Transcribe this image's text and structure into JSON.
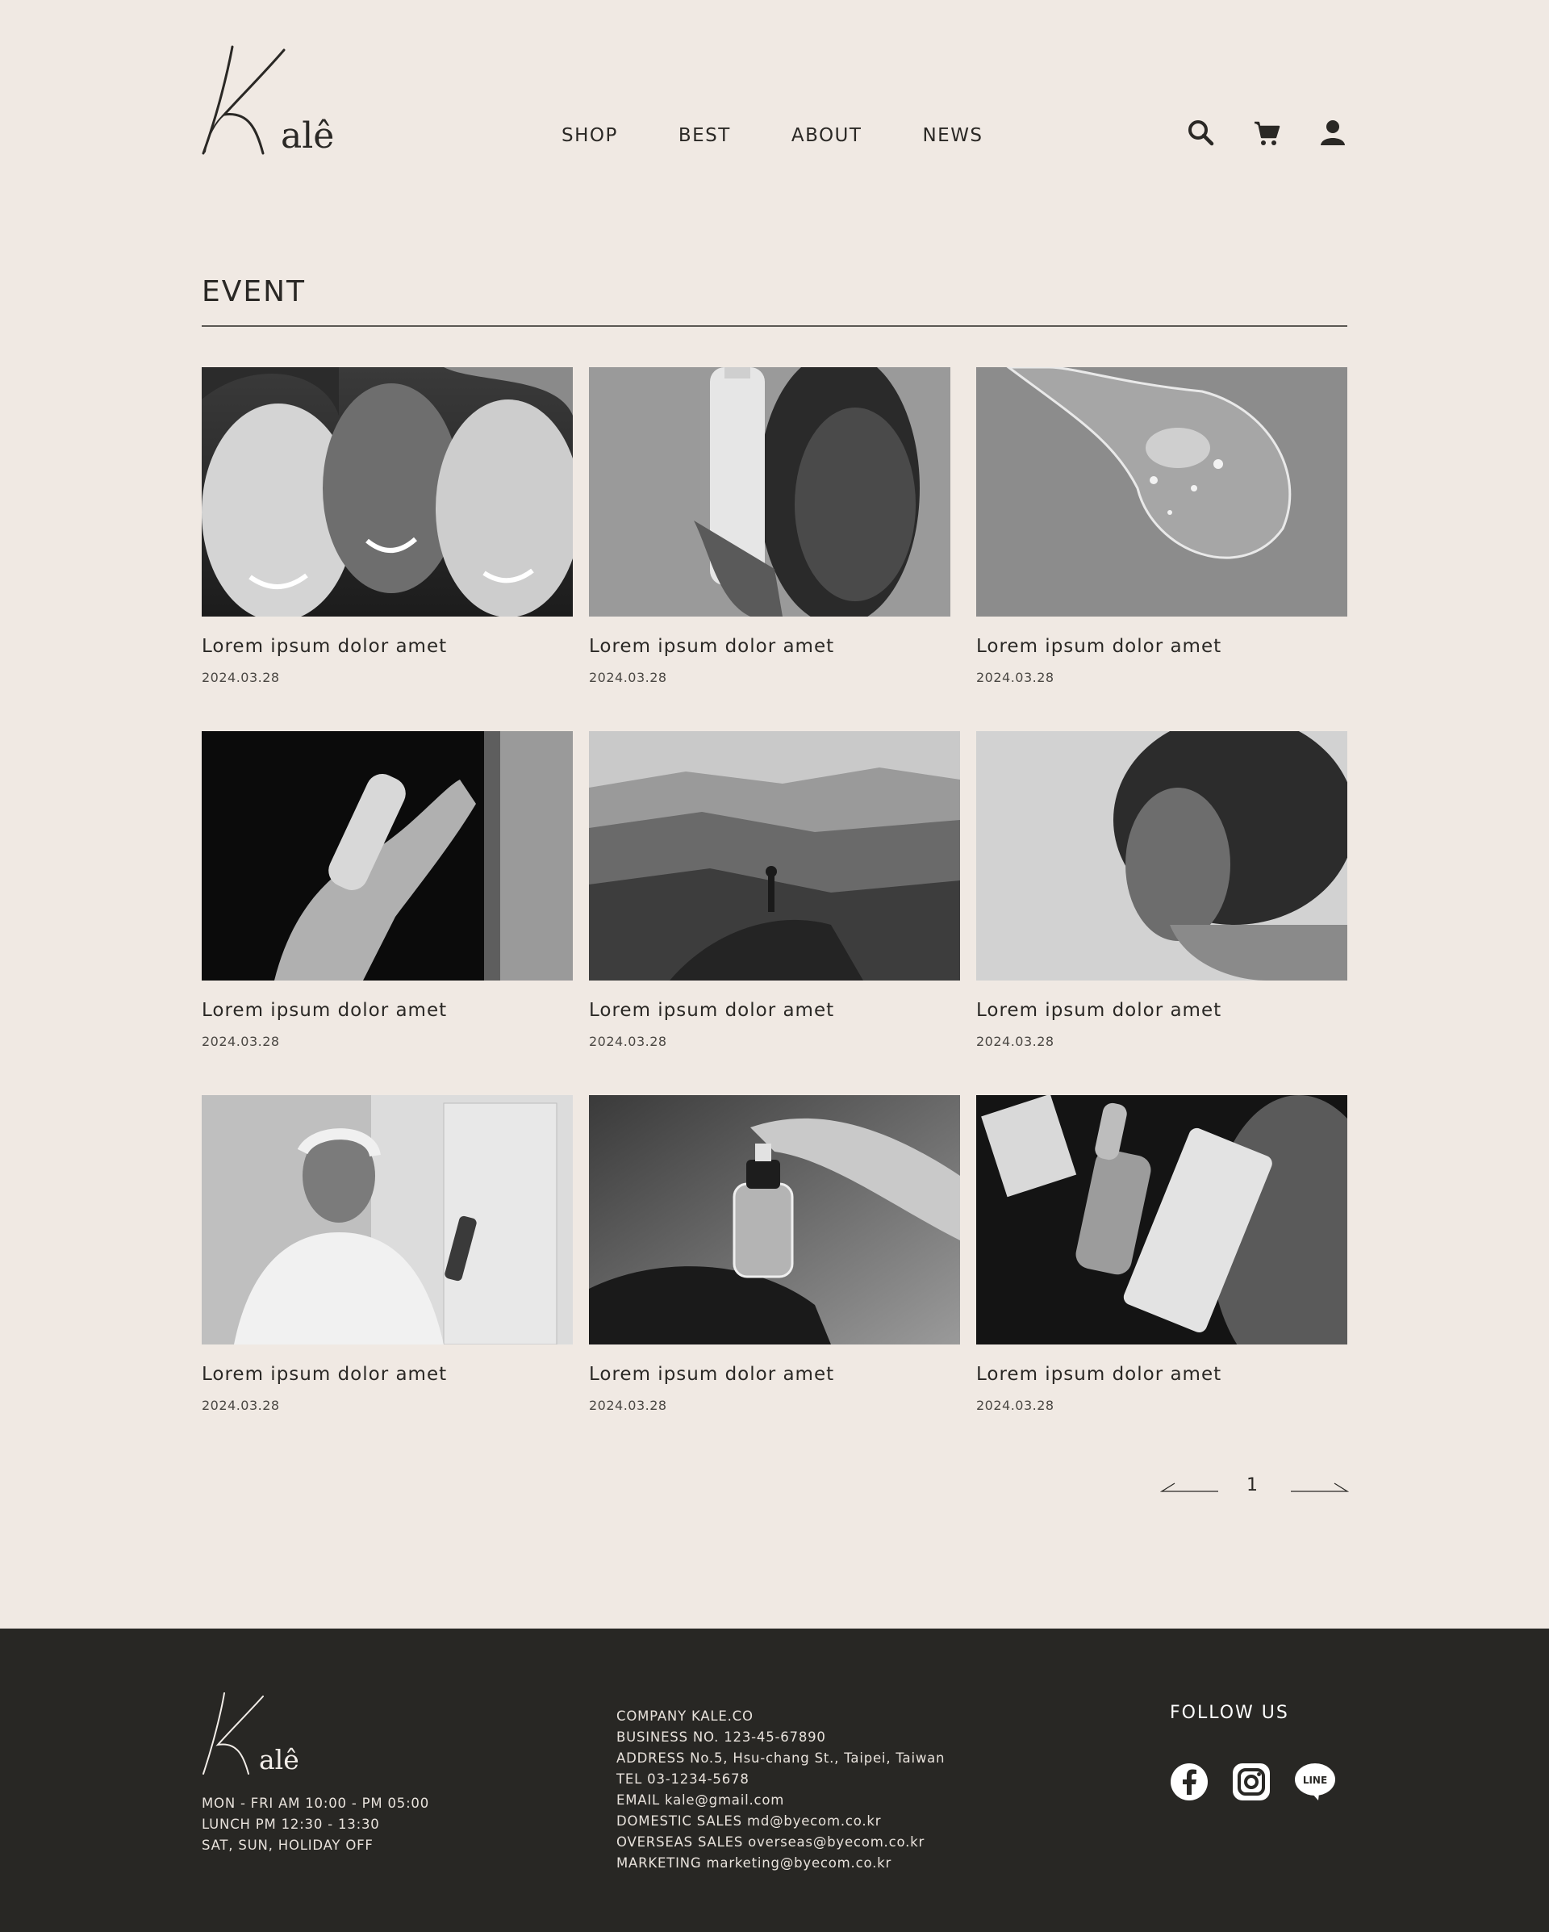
{
  "brand": {
    "logo_text": "Kalê",
    "logo_icon": "kale-script-logo"
  },
  "nav": {
    "items": [
      "SHOP",
      "BEST",
      "ABOUT",
      "NEWS"
    ]
  },
  "header_icons": [
    "search-icon",
    "cart-icon",
    "user-icon"
  ],
  "section": {
    "title": "EVENT"
  },
  "events": [
    {
      "title": "Lorem ipsum dolor amet",
      "date": "2024.03.28",
      "image": "three-women-smiling"
    },
    {
      "title": "Lorem ipsum dolor amet",
      "date": "2024.03.28",
      "image": "woman-holding-bottle"
    },
    {
      "title": "Lorem ipsum dolor amet",
      "date": "2024.03.28",
      "image": "gel-droplet"
    },
    {
      "title": "Lorem ipsum dolor amet",
      "date": "2024.03.28",
      "image": "hands-with-foam-bottle"
    },
    {
      "title": "Lorem ipsum dolor amet",
      "date": "2024.03.28",
      "image": "yoga-on-mountain"
    },
    {
      "title": "Lorem ipsum dolor amet",
      "date": "2024.03.28",
      "image": "woman-curly-hair-profile"
    },
    {
      "title": "Lorem ipsum dolor amet",
      "date": "2024.03.28",
      "image": "woman-spraying-mist"
    },
    {
      "title": "Lorem ipsum dolor amet",
      "date": "2024.03.28",
      "image": "dropper-bottle-on-hand"
    },
    {
      "title": "Lorem ipsum dolor amet",
      "date": "2024.03.28",
      "image": "serum-and-tube-products"
    }
  ],
  "pagination": {
    "current": "1"
  },
  "footer": {
    "hours": [
      "MON - FRI AM 10:00 - PM 05:00",
      "LUNCH PM 12:30 - 13:30",
      "SAT, SUN, HOLIDAY OFF"
    ],
    "company": [
      "COMPANY KALE.CO",
      "BUSINESS NO. 123-45-67890",
      "ADDRESS No.5, Hsu-chang St., Taipei, Taiwan",
      "TEL 03-1234-5678",
      "EMAIL kale@gmail.com",
      "DOMESTIC SALES md@byecom.co.kr",
      "OVERSEAS SALES overseas@byecom.co.kr",
      "MARKETING marketing@byecom.co.kr"
    ],
    "follow_label": "FOLLOW US",
    "socials": [
      "facebook-icon",
      "instagram-icon",
      "line-icon"
    ],
    "line_badge": "LINE"
  },
  "colors": {
    "background": "#f0e9e3",
    "text": "#2a2825",
    "footer_bg": "#282724",
    "footer_text": "#e8e2dc"
  }
}
